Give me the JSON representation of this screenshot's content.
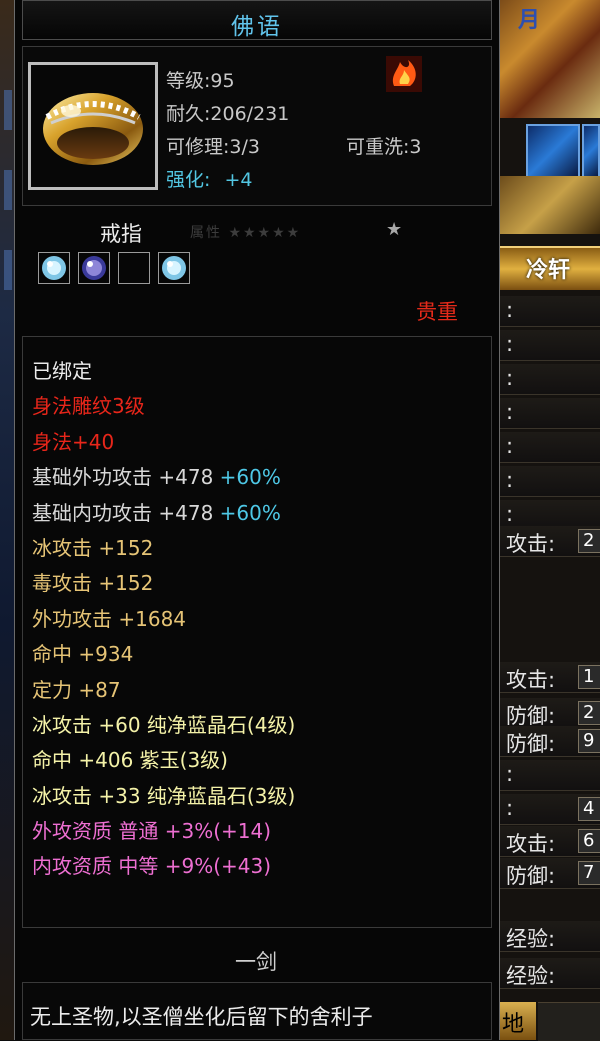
{
  "background": {
    "banner_text": "月",
    "tab_label": "冷轩",
    "stat_rows": [
      {
        "label": ":",
        "value": ""
      },
      {
        "label": ":",
        "value": ""
      },
      {
        "label": ":",
        "value": ""
      },
      {
        "label": ":",
        "value": ""
      },
      {
        "label": ":",
        "value": ""
      },
      {
        "label": ":",
        "value": ""
      },
      {
        "label": ":",
        "value": ""
      },
      {
        "label": "攻击:",
        "value": "2"
      },
      {
        "label": "攻击:",
        "value": "1"
      },
      {
        "label": "防御:",
        "value": "2"
      },
      {
        "label": "防御:",
        "value": "9"
      },
      {
        "label": ":",
        "value": ""
      },
      {
        "label": ":",
        "value": "4"
      },
      {
        "label": "攻击:",
        "value": "6"
      },
      {
        "label": "防御:",
        "value": "7"
      },
      {
        "label": "经验:",
        "value": ""
      },
      {
        "label": "经验:",
        "value": ""
      }
    ],
    "bottom_tab": "地"
  },
  "tooltip": {
    "title": "佛语",
    "item_icon": "gold-ring-with-diamonds",
    "level_line": "等级:95",
    "durability_line": "耐久:206/231",
    "repairable_line": "可修理:3/3",
    "rewash_line": "可重洗:3",
    "enhance_label": "强化:",
    "enhance_value": "+4",
    "element_icon": "fire-icon",
    "type": "戒指",
    "sockets": [
      {
        "gem": "ice-crystal",
        "color": "#7fc6e6"
      },
      {
        "gem": "purple-jade",
        "color": "#8e86d8"
      },
      {
        "gem": "empty",
        "color": "#000000"
      },
      {
        "gem": "ice-crystal",
        "color": "#7fc6e6"
      }
    ],
    "faint_text": "属性  ★★★★★",
    "star": "★",
    "rarity": "贵重",
    "attributes": [
      {
        "parts": [
          {
            "t": "已绑定",
            "c": "#ececec"
          }
        ]
      },
      {
        "parts": [
          {
            "t": "身法雕纹3级",
            "c": "#e8261a"
          }
        ]
      },
      {
        "parts": [
          {
            "t": "身法+40",
            "c": "#e8261a"
          }
        ]
      },
      {
        "parts": [
          {
            "t": "基础外功攻击  +478 ",
            "c": "#d8d8d8"
          },
          {
            "t": "+60%",
            "c": "#4ec8e6"
          }
        ]
      },
      {
        "parts": [
          {
            "t": "基础内功攻击  +478 ",
            "c": "#d8d8d8"
          },
          {
            "t": "+60%",
            "c": "#4ec8e6"
          }
        ]
      },
      {
        "parts": [
          {
            "t": "冰攻击  +152",
            "c": "#e6c476"
          }
        ]
      },
      {
        "parts": [
          {
            "t": "毒攻击  +152",
            "c": "#e6c476"
          }
        ]
      },
      {
        "parts": [
          {
            "t": "外功攻击  +1684",
            "c": "#e6c476"
          }
        ]
      },
      {
        "parts": [
          {
            "t": "命中  +934",
            "c": "#e6c476"
          }
        ]
      },
      {
        "parts": [
          {
            "t": "定力  +87",
            "c": "#e6c476"
          }
        ]
      },
      {
        "parts": [
          {
            "t": "冰攻击  +60  纯净蓝晶石(4级)",
            "c": "#f4f2a8"
          }
        ]
      },
      {
        "parts": [
          {
            "t": "命中  +406  紫玉(3级)",
            "c": "#f4f2a8"
          }
        ]
      },
      {
        "parts": [
          {
            "t": "冰攻击  +33  纯净蓝晶石(3级)",
            "c": "#f4f2a8"
          }
        ]
      },
      {
        "parts": [
          {
            "t": "外攻资质   普通  +3%(+14)",
            "c": "#ee6fd2"
          }
        ]
      },
      {
        "parts": [
          {
            "t": "内攻资质   中等  +9%(+43)",
            "c": "#ee6fd2"
          }
        ]
      }
    ],
    "subtitle": "一剑",
    "description": "无上圣物,以圣僧坐化后留下的舍利子"
  }
}
